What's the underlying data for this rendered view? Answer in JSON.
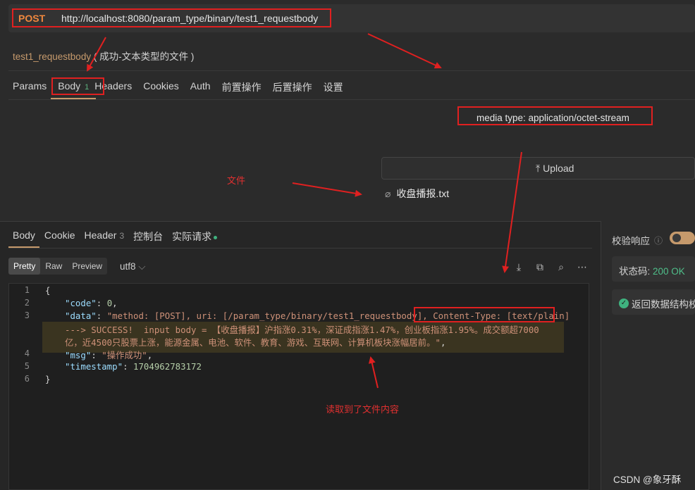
{
  "request": {
    "method": "POST",
    "url": "http://localhost:8080/param_type/binary/test1_requestbody",
    "name": "test1_requestbody",
    "description": "( 成功-文本类型的文件 )"
  },
  "tabs": [
    {
      "label": "Params"
    },
    {
      "label": "Body",
      "badge": "1"
    },
    {
      "label": "Headers"
    },
    {
      "label": "Cookies"
    },
    {
      "label": "Auth"
    },
    {
      "label": "前置操作"
    },
    {
      "label": "后置操作"
    },
    {
      "label": "设置"
    }
  ],
  "body": {
    "media_type": "media type: application/octet-stream",
    "upload_label": "Upload",
    "file_name": "收盘播报.txt"
  },
  "annotations": {
    "file": "文件",
    "read": "读取到了文件内容"
  },
  "response": {
    "tabs": [
      {
        "label": "Body"
      },
      {
        "label": "Cookie"
      },
      {
        "label": "Header",
        "badge": "3"
      },
      {
        "label": "控制台"
      },
      {
        "label": "实际请求"
      }
    ],
    "formats": [
      "Pretty",
      "Raw",
      "Preview"
    ],
    "encoding": "utf8",
    "line_numbers": [
      "1",
      "2",
      "3",
      "",
      "",
      "4",
      "5",
      "6"
    ],
    "lines": {
      "l1": "{",
      "code_key": "\"code\"",
      "code_val": "0",
      "data_key": "\"data\"",
      "data_val_a": "\"method: [POST], uri: [/param_type/binary/test1_requestbody], ",
      "data_val_ct": "Content-Type: [text/plain]",
      "data_val_b": "---> SUCCESS!  input body = 【收盘播报】沪指涨0.31%，深证成指涨1.47%，创业板指涨1.95%。成交额超7000",
      "data_val_c": "亿，近4500只股票上涨，能源金属、电池、软件、教育、游戏、互联网、计算机板块涨幅居前。\"",
      "msg_key": "\"msg\"",
      "msg_val": "\"操作成功\"",
      "ts_key": "\"timestamp\"",
      "ts_val": "1704962783172",
      "l6": "}"
    }
  },
  "side": {
    "verify_label": "校验响应",
    "status_label": "状态码:",
    "status_value": "200 OK",
    "schema_label": "返回数据结构校"
  },
  "watermark": "CSDN @象牙酥",
  "colors": {
    "accent": "#c69a6c",
    "method": "#f0883e",
    "success": "#3fb27f",
    "annotation_red": "#e02020"
  }
}
